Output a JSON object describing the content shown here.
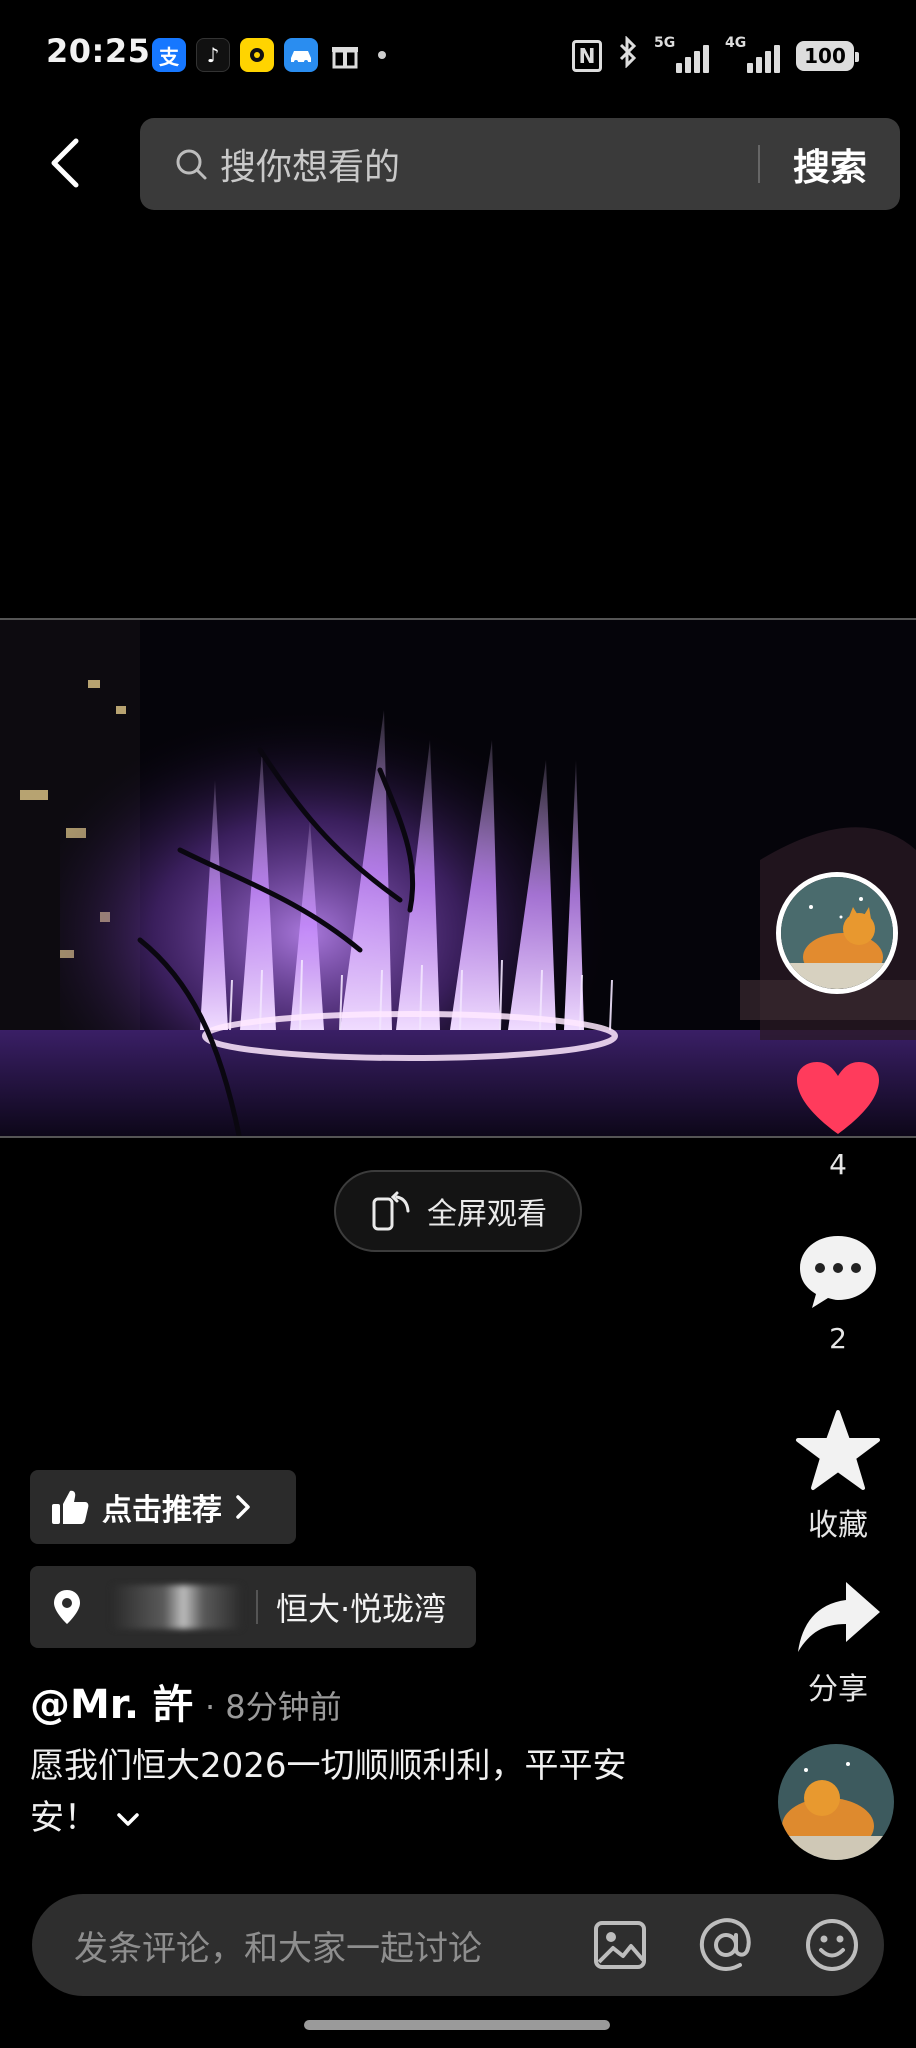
{
  "status_bar": {
    "time": "20:25",
    "notification_icons": [
      "alipay-icon",
      "tiktok-icon",
      "game-center-icon",
      "car-app-icon",
      "gift-icon"
    ],
    "alipay_glyph": "支",
    "tiktok_glyph": "♪",
    "network_5g": "5G",
    "network_4g": "4G",
    "battery": "100"
  },
  "search": {
    "placeholder": "搜你想看的",
    "button_label": "搜索"
  },
  "video": {
    "fullscreen_label": "全屏观看",
    "dominant_color": "#b36bff"
  },
  "rail": {
    "like_count": "4",
    "like_color": "#ff3b5c",
    "comment_count": "2",
    "favorite_label": "收藏",
    "share_label": "分享"
  },
  "post": {
    "recommend_label": "点击推荐",
    "location_name": "恒大·悦珑湾",
    "author": "@Mr. 許",
    "posted_time": "· 8分钟前",
    "caption": "愿我们恒大2026一切顺顺利利，平平安安！"
  },
  "comment_bar": {
    "placeholder": "发条评论，和大家一起讨论"
  }
}
